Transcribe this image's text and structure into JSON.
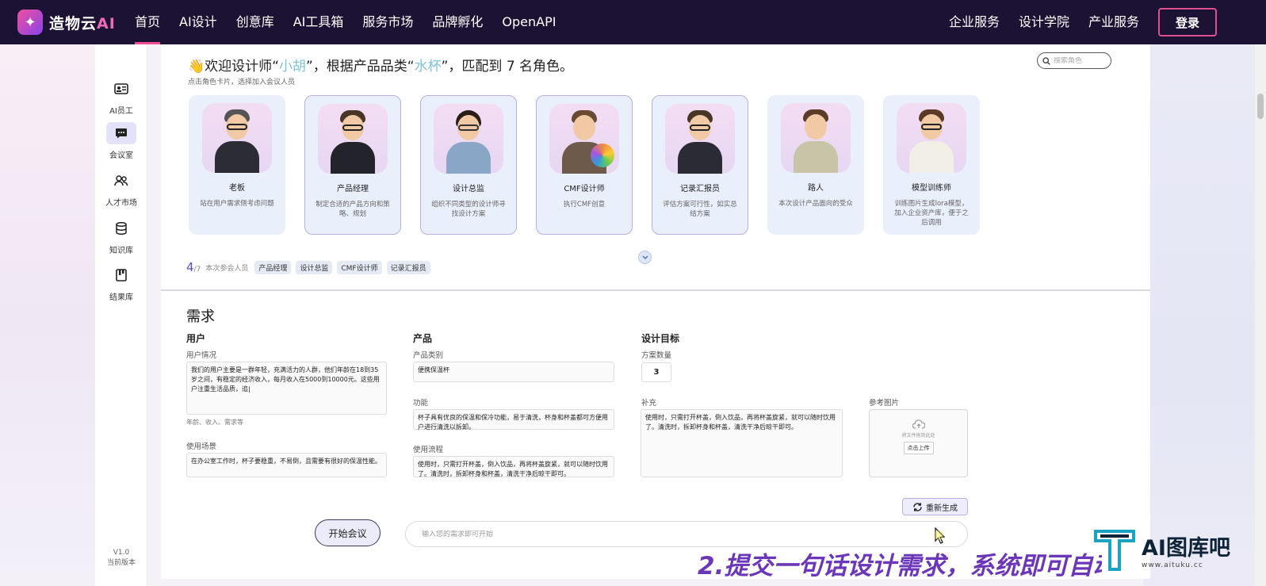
{
  "nav": {
    "logo_text": "造物云",
    "logo_ai": "AI",
    "links": [
      "首页",
      "AI设计",
      "创意库",
      "AI工具箱",
      "服务市场",
      "品牌孵化",
      "OpenAPI"
    ],
    "right_links": [
      "企业服务",
      "设计学院",
      "产业服务"
    ],
    "login": "登录",
    "accent_color": "#ec4f8f"
  },
  "sidebar": {
    "items": [
      {
        "label": "AI员工",
        "icon": "id-card-icon"
      },
      {
        "label": "会议室",
        "icon": "chat-icon"
      },
      {
        "label": "人才市场",
        "icon": "users-icon"
      },
      {
        "label": "知识库",
        "icon": "database-icon"
      },
      {
        "label": "结果库",
        "icon": "bookmark-icon"
      }
    ],
    "active": "会议室",
    "version": "V1.0",
    "version_label": "当前版本"
  },
  "welcome": {
    "prefix": "👋欢迎设计师“",
    "designer": "小胡",
    "middle": "”，根据产品品类“",
    "category": "水杯",
    "suffix": "”，匹配到 7 名角色。",
    "hint": "点击角色卡片，选择加入会议人员",
    "search_placeholder": "搜索角色"
  },
  "roles": [
    {
      "title": "老板",
      "desc": "站在用户需求侧考虑问题",
      "selected": false
    },
    {
      "title": "产品经理",
      "desc": "制定合适的产品方向和策略、规划",
      "selected": true
    },
    {
      "title": "设计总监",
      "desc": "组织不同类型的设计师寻找设计方案",
      "selected": true
    },
    {
      "title": "CMF设计师",
      "desc": "执行CMF创意",
      "selected": true
    },
    {
      "title": "记录汇报员",
      "desc": "评估方案可行性，如实总结方案",
      "selected": true
    },
    {
      "title": "路人",
      "desc": "本次设计产品面向的受众",
      "selected": false
    },
    {
      "title": "模型训练师",
      "desc": "训练图片生成lora模型，加入企业资产库，便于之后调用",
      "selected": false
    }
  ],
  "attendees": {
    "count": "4",
    "total": "/7",
    "label": "本次参会人员",
    "tags": [
      "产品经理",
      "设计总监",
      "CMF设计师",
      "记录汇报员"
    ]
  },
  "requirements": {
    "title": "需求",
    "user": {
      "title": "用户",
      "situation_label": "用户情况",
      "situation": "我们的用户主要是一群年轻，充满活力的人群，他们年龄在18到35岁之间，有稳定的经济收入，每月收入在5000到10000元。这些用户注重生活品质，追|",
      "situation_hint": "年龄、收入、需求等",
      "scene_label": "使用场景",
      "scene": "在办公室工作时，杯子要稳重，不易倒，且需要有很好的保温性能。"
    },
    "product": {
      "title": "产品",
      "category_label": "产品类别",
      "category": "便携保温杯",
      "function_label": "功能",
      "function": "杯子具有优良的保温和保冷功能，易于清洗，杯身和杯盖都可方便用户进行清洗以拆卸。",
      "flow_label": "使用流程",
      "flow": "使用时，只需打开杯盖，倒入饮品，再将杯盖旋紧，就可以随时饮用了。清洗时，拆卸杯身和杯盖，清洗干净后晾干即可。"
    },
    "goal": {
      "title": "设计目标",
      "count_label": "方案数量",
      "count": "3",
      "supplement_label": "补充",
      "supplement": "使用时，只需打开杯盖，倒入饮品，再将杯盖旋紧，就可以随时饮用了。清洗时，拆卸杯身和杯盖，清洗干净后晾干即可。",
      "ref_label": "参考图片",
      "upload_text": "将文件拖到此处",
      "upload_button": "点击上传"
    },
    "regenerate": "重新生成",
    "start": "开始会议",
    "prompt_placeholder": "输入您的需求即可开始"
  },
  "overlay": {
    "caption": "2.提交一句话设计需求，系统即可自动",
    "watermark_title": "AI图库吧",
    "watermark_url": "www.aituku.cc"
  }
}
